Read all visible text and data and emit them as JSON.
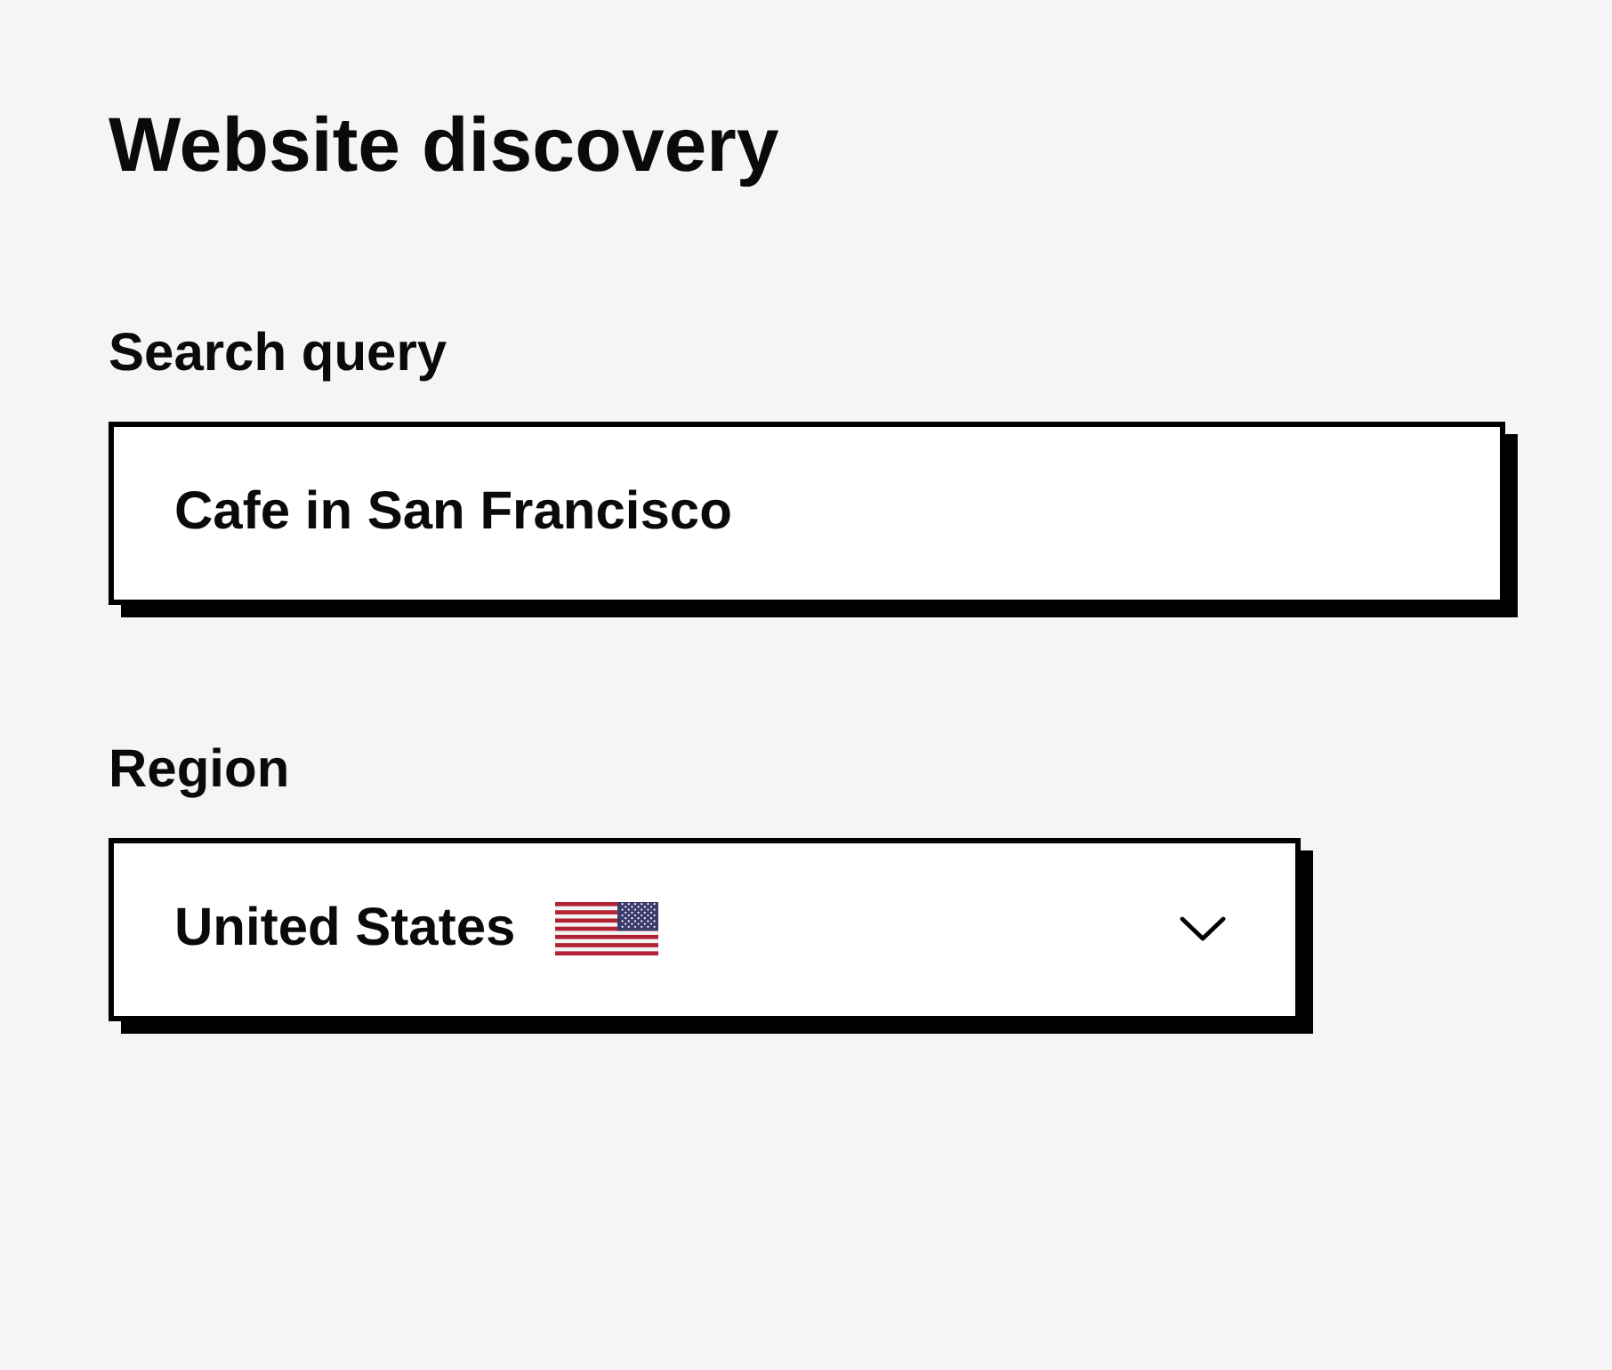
{
  "title": "Website discovery",
  "fields": [
    {
      "kind": "text",
      "label": "Search query",
      "value": "Cafe in San Francisco"
    },
    {
      "kind": "select",
      "label": "Region",
      "value": "United States"
    }
  ]
}
